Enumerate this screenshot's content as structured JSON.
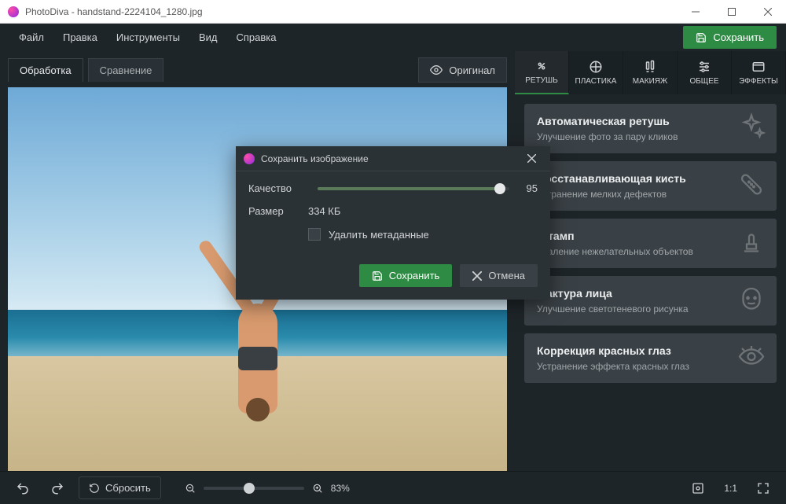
{
  "window": {
    "title": "PhotoDiva - handstand-2224104_1280.jpg"
  },
  "menu": {
    "items": [
      "Файл",
      "Правка",
      "Инструменты",
      "Вид",
      "Справка"
    ]
  },
  "buttons": {
    "save_main": "Сохранить",
    "reset": "Сбросить",
    "original": "Оригинал"
  },
  "tabs": {
    "edit": "Обработка",
    "compare": "Сравнение"
  },
  "zoom": {
    "percent": "83%",
    "one_to_one": "1:1"
  },
  "tool_tabs": [
    "РЕТУШЬ",
    "ПЛАСТИКА",
    "МАКИЯЖ",
    "ОБЩЕЕ",
    "ЭФФЕКТЫ"
  ],
  "cards": [
    {
      "title": "Автоматическая ретушь",
      "sub": "Улучшение фото за пару кликов"
    },
    {
      "title": "Восстанавливающая кисть",
      "sub": "Устранение мелких дефектов"
    },
    {
      "title": "Штамп",
      "sub": "Удаление нежелательных объектов"
    },
    {
      "title": "Фактура лица",
      "sub": "Улучшение светотеневого рисунка"
    },
    {
      "title": "Коррекция красных глаз",
      "sub": "Устранение эффекта красных глаз"
    }
  ],
  "modal": {
    "title": "Сохранить изображение",
    "quality_label": "Качество",
    "quality_value": "95",
    "size_label": "Размер",
    "size_value": "334 КБ",
    "strip_meta": "Удалить метаданные",
    "save": "Сохранить",
    "cancel": "Отмена"
  }
}
